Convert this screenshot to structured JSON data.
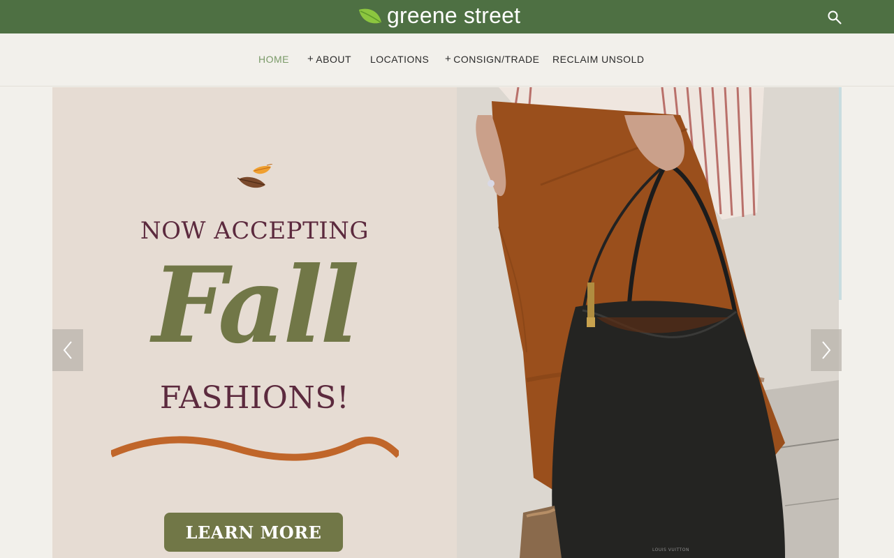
{
  "brand": {
    "name": "greene street",
    "logo_icon": "leaf-icon",
    "bar_color": "#4e7043"
  },
  "header": {
    "search_icon": "search-icon"
  },
  "nav": {
    "items": [
      {
        "label": "HOME",
        "expandable": false,
        "active": true
      },
      {
        "label": "ABOUT",
        "expandable": true,
        "active": false
      },
      {
        "label": "LOCATIONS",
        "expandable": false,
        "active": false
      },
      {
        "label": "CONSIGN/TRADE",
        "expandable": true,
        "active": false
      },
      {
        "label": "RECLAIM UNSOLD",
        "expandable": false,
        "active": false
      }
    ],
    "expand_symbol": "+",
    "active_color": "#7a9a68"
  },
  "hero": {
    "line1": "NOW ACCEPTING",
    "line2": "Fall",
    "line3": "FASHIONS!",
    "cta_label": "LEARN MORE",
    "bag_brand_text": "LOUIS VUITTON",
    "colors": {
      "accent_plum": "#5c2a3e",
      "olive": "#717747",
      "rust": "#c0662a",
      "panel": "#e6dcd3"
    },
    "prev_icon": "chevron-left-icon",
    "next_icon": "chevron-right-icon"
  }
}
